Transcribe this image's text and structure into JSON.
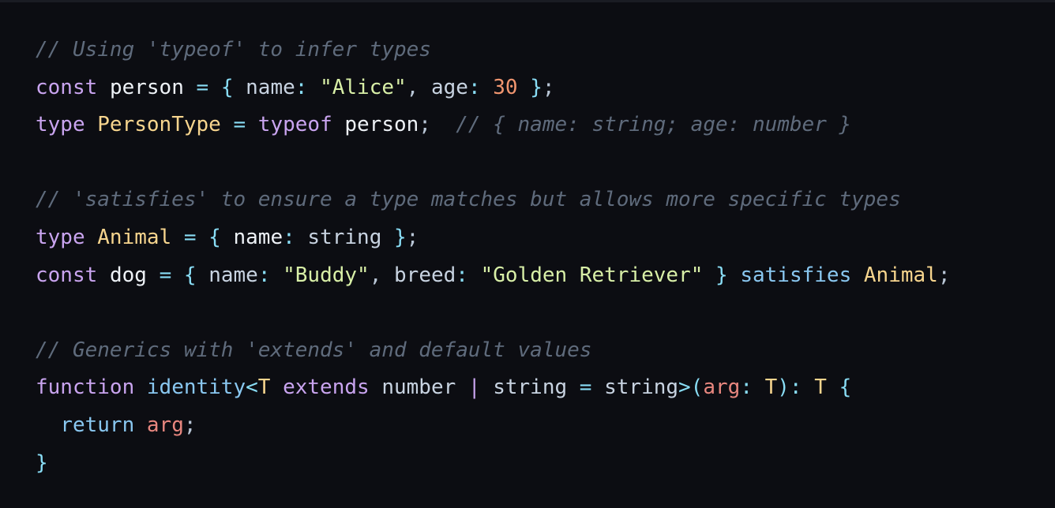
{
  "code": {
    "lines": [
      [
        {
          "k": "comment",
          "t": "// Using 'typeof' to infer types"
        }
      ],
      [
        {
          "k": "keyword",
          "t": "const"
        },
        {
          "k": "plain",
          "t": " "
        },
        {
          "k": "var",
          "t": "person"
        },
        {
          "k": "plain",
          "t": " "
        },
        {
          "k": "op",
          "t": "="
        },
        {
          "k": "plain",
          "t": " "
        },
        {
          "k": "op",
          "t": "{"
        },
        {
          "k": "plain",
          "t": " "
        },
        {
          "k": "prop",
          "t": "name"
        },
        {
          "k": "op",
          "t": ":"
        },
        {
          "k": "plain",
          "t": " "
        },
        {
          "k": "string",
          "t": "\"Alice\""
        },
        {
          "k": "punct",
          "t": ","
        },
        {
          "k": "plain",
          "t": " "
        },
        {
          "k": "prop",
          "t": "age"
        },
        {
          "k": "op",
          "t": ":"
        },
        {
          "k": "plain",
          "t": " "
        },
        {
          "k": "number",
          "t": "30"
        },
        {
          "k": "plain",
          "t": " "
        },
        {
          "k": "op",
          "t": "}"
        },
        {
          "k": "punct",
          "t": ";"
        }
      ],
      [
        {
          "k": "keyword",
          "t": "type"
        },
        {
          "k": "plain",
          "t": " "
        },
        {
          "k": "type",
          "t": "PersonType"
        },
        {
          "k": "plain",
          "t": " "
        },
        {
          "k": "op",
          "t": "="
        },
        {
          "k": "plain",
          "t": " "
        },
        {
          "k": "keyword",
          "t": "typeof"
        },
        {
          "k": "plain",
          "t": " "
        },
        {
          "k": "var",
          "t": "person"
        },
        {
          "k": "punct",
          "t": ";"
        },
        {
          "k": "plain",
          "t": "  "
        },
        {
          "k": "comment",
          "t": "// { name: string; age: number }"
        }
      ],
      [],
      [
        {
          "k": "comment",
          "t": "// 'satisfies' to ensure a type matches but allows more specific types"
        }
      ],
      [
        {
          "k": "keyword",
          "t": "type"
        },
        {
          "k": "plain",
          "t": " "
        },
        {
          "k": "type",
          "t": "Animal"
        },
        {
          "k": "plain",
          "t": " "
        },
        {
          "k": "op",
          "t": "="
        },
        {
          "k": "plain",
          "t": " "
        },
        {
          "k": "op",
          "t": "{"
        },
        {
          "k": "plain",
          "t": " "
        },
        {
          "k": "var",
          "t": "name"
        },
        {
          "k": "op",
          "t": ":"
        },
        {
          "k": "plain",
          "t": " "
        },
        {
          "k": "prop",
          "t": "string"
        },
        {
          "k": "plain",
          "t": " "
        },
        {
          "k": "op",
          "t": "}"
        },
        {
          "k": "punct",
          "t": ";"
        }
      ],
      [
        {
          "k": "keyword",
          "t": "const"
        },
        {
          "k": "plain",
          "t": " "
        },
        {
          "k": "var",
          "t": "dog"
        },
        {
          "k": "plain",
          "t": " "
        },
        {
          "k": "op",
          "t": "="
        },
        {
          "k": "plain",
          "t": " "
        },
        {
          "k": "op",
          "t": "{"
        },
        {
          "k": "plain",
          "t": " "
        },
        {
          "k": "prop",
          "t": "name"
        },
        {
          "k": "op",
          "t": ":"
        },
        {
          "k": "plain",
          "t": " "
        },
        {
          "k": "string",
          "t": "\"Buddy\""
        },
        {
          "k": "punct",
          "t": ","
        },
        {
          "k": "plain",
          "t": " "
        },
        {
          "k": "prop",
          "t": "breed"
        },
        {
          "k": "op",
          "t": ":"
        },
        {
          "k": "plain",
          "t": " "
        },
        {
          "k": "string",
          "t": "\"Golden Retriever\""
        },
        {
          "k": "plain",
          "t": " "
        },
        {
          "k": "op",
          "t": "}"
        },
        {
          "k": "plain",
          "t": " "
        },
        {
          "k": "func",
          "t": "satisfies"
        },
        {
          "k": "plain",
          "t": " "
        },
        {
          "k": "type",
          "t": "Animal"
        },
        {
          "k": "punct",
          "t": ";"
        }
      ],
      [],
      [
        {
          "k": "comment",
          "t": "// Generics with 'extends' and default values"
        }
      ],
      [
        {
          "k": "keyword",
          "t": "function"
        },
        {
          "k": "plain",
          "t": " "
        },
        {
          "k": "func",
          "t": "identity"
        },
        {
          "k": "op",
          "t": "<"
        },
        {
          "k": "type",
          "t": "T"
        },
        {
          "k": "plain",
          "t": " "
        },
        {
          "k": "keyword",
          "t": "extends"
        },
        {
          "k": "plain",
          "t": " "
        },
        {
          "k": "prop",
          "t": "number"
        },
        {
          "k": "plain",
          "t": " "
        },
        {
          "k": "keyword",
          "t": "|"
        },
        {
          "k": "plain",
          "t": " "
        },
        {
          "k": "prop",
          "t": "string"
        },
        {
          "k": "plain",
          "t": " "
        },
        {
          "k": "op",
          "t": "="
        },
        {
          "k": "plain",
          "t": " "
        },
        {
          "k": "prop",
          "t": "string"
        },
        {
          "k": "op",
          "t": ">("
        },
        {
          "k": "param",
          "t": "arg"
        },
        {
          "k": "op",
          "t": ":"
        },
        {
          "k": "plain",
          "t": " "
        },
        {
          "k": "type",
          "t": "T"
        },
        {
          "k": "op",
          "t": "):"
        },
        {
          "k": "plain",
          "t": " "
        },
        {
          "k": "type",
          "t": "T"
        },
        {
          "k": "plain",
          "t": " "
        },
        {
          "k": "op",
          "t": "{"
        }
      ],
      [
        {
          "k": "plain",
          "t": "  "
        },
        {
          "k": "func",
          "t": "return"
        },
        {
          "k": "plain",
          "t": " "
        },
        {
          "k": "param",
          "t": "arg"
        },
        {
          "k": "punct",
          "t": ";"
        }
      ],
      [
        {
          "k": "op",
          "t": "}"
        }
      ]
    ]
  }
}
